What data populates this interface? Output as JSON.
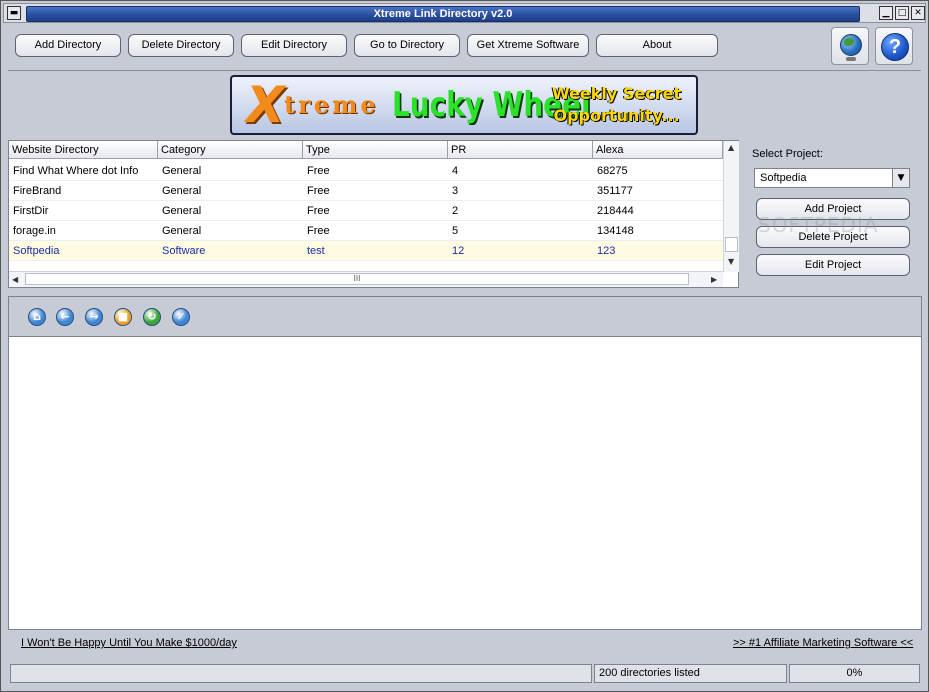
{
  "window": {
    "title": "Xtreme Link Directory v2.0",
    "controls": {
      "minimize": "▁",
      "maximize": "□",
      "close": "✕",
      "system": "▬"
    }
  },
  "toolbar": {
    "buttons": [
      {
        "label": "Add Directory"
      },
      {
        "label": "Delete Directory"
      },
      {
        "label": "Edit Directory"
      },
      {
        "label": "Go to Directory"
      },
      {
        "label": "Get Xtreme Software"
      },
      {
        "label": "About"
      }
    ],
    "icons": [
      "globe-icon",
      "help-icon"
    ],
    "help_glyph": "?"
  },
  "banner": {
    "x": "X",
    "treme": "treme",
    "lucky": "Lucky Wheel",
    "weekly_line1": "Weekly Secret",
    "weekly_line2": "Opportunity..."
  },
  "table": {
    "columns": [
      "Website Directory",
      "Category",
      "Type",
      "PR",
      "Alexa"
    ],
    "rows": [
      {
        "name": "Find What Where dot Info",
        "category": "General",
        "type": "Free",
        "pr": "4",
        "alexa": "68275"
      },
      {
        "name": "FireBrand",
        "category": "General",
        "type": "Free",
        "pr": "3",
        "alexa": "351177"
      },
      {
        "name": "FirstDir",
        "category": "General",
        "type": "Free",
        "pr": "2",
        "alexa": "218444"
      },
      {
        "name": "forage.in",
        "category": "General",
        "type": "Free",
        "pr": "5",
        "alexa": "134148"
      },
      {
        "name": "Softpedia",
        "category": "Software",
        "type": "test",
        "pr": "12",
        "alexa": "123"
      }
    ],
    "selected_row": 4,
    "hscroll_grip": "III"
  },
  "project": {
    "label": "Select Project:",
    "selected": "Softpedia",
    "add_label": "Add Project",
    "delete_label": "Delete Project",
    "edit_label": "Edit Project"
  },
  "nav": {
    "icons": [
      {
        "name": "home-icon",
        "glyph": "⌂",
        "color": "#3f86d6"
      },
      {
        "name": "back-icon",
        "glyph": "←",
        "color": "#3f86d6"
      },
      {
        "name": "forward-icon",
        "glyph": "→",
        "color": "#3f86d6"
      },
      {
        "name": "stop-icon",
        "glyph": "■",
        "color": "#f0a020"
      },
      {
        "name": "refresh-icon",
        "glyph": "↻",
        "color": "#3aa53a"
      },
      {
        "name": "check-icon",
        "glyph": "✓",
        "color": "#3f86d6"
      }
    ]
  },
  "links": {
    "left": "I Won't Be Happy Until You Make $1000/day",
    "right": ">> #1 Affiliate Marketing Software <<"
  },
  "status": {
    "left": "",
    "count": "200 directories listed",
    "progress": "0%"
  },
  "watermark": "SOFTPEDIA"
}
